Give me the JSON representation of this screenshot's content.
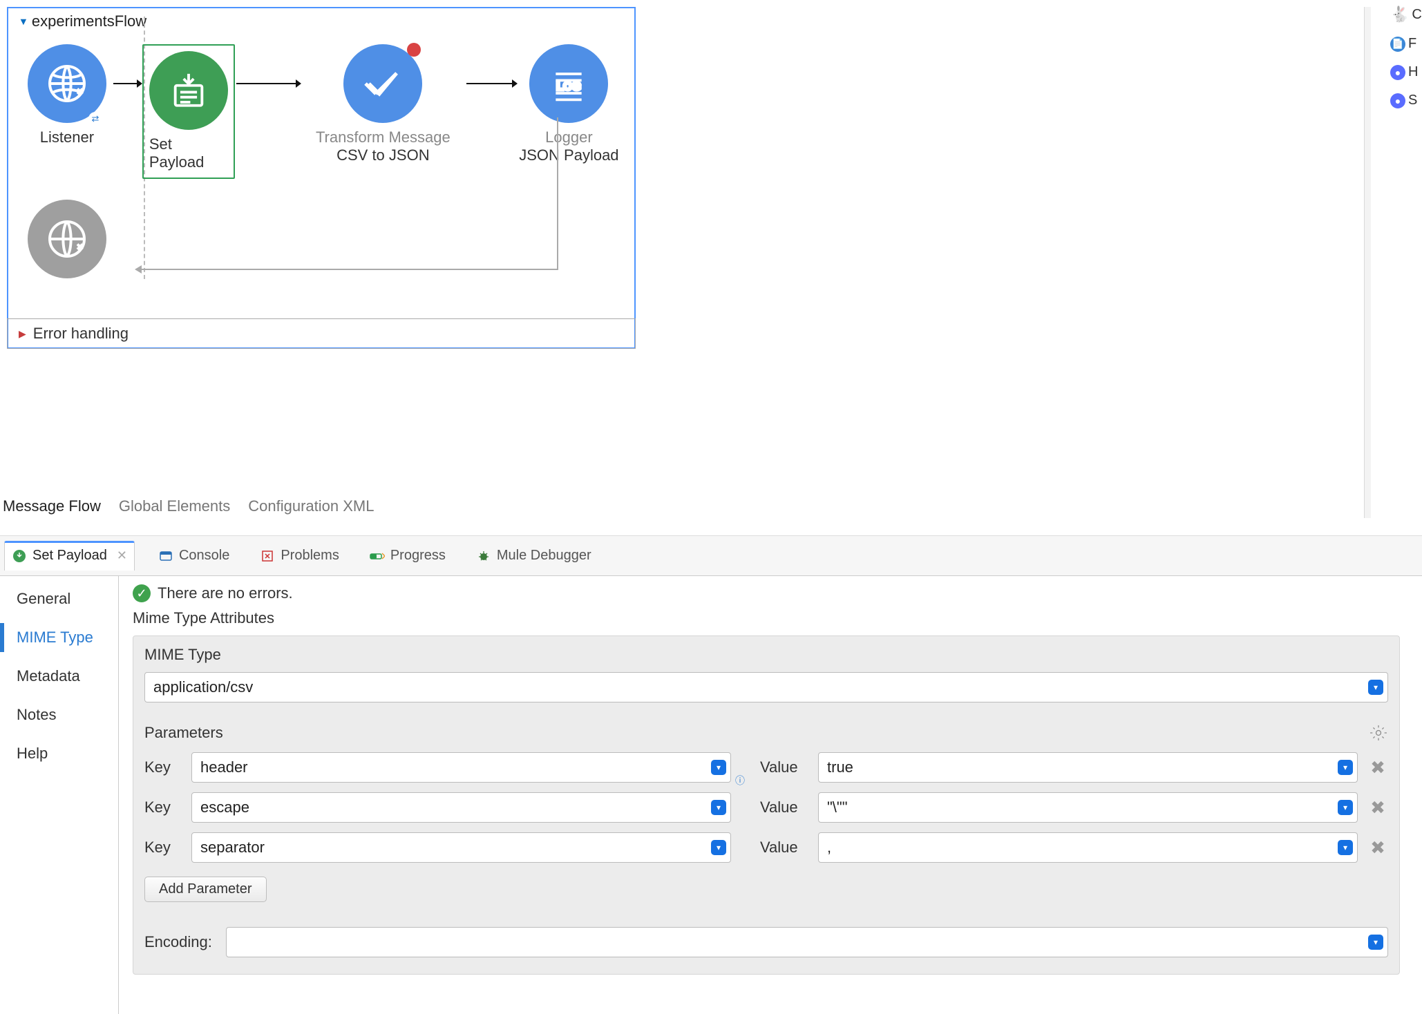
{
  "flow": {
    "name": "experimentsFlow",
    "error_handling_label": "Error handling",
    "nodes": {
      "listener": {
        "label": "Listener"
      },
      "setpayload": {
        "label": "Set Payload"
      },
      "transform": {
        "label1": "Transform Message",
        "label2": "CSV to JSON"
      },
      "logger": {
        "label1": "Logger",
        "label2": "JSON Payload"
      }
    }
  },
  "canvas_tabs": {
    "message_flow": "Message Flow",
    "global_elements": "Global Elements",
    "config_xml": "Configuration XML"
  },
  "bottom_tabs": {
    "set_payload": "Set Payload",
    "console": "Console",
    "problems": "Problems",
    "progress": "Progress",
    "debugger": "Mule Debugger"
  },
  "side_nav": {
    "general": "General",
    "mime": "MIME Type",
    "metadata": "Metadata",
    "notes": "Notes",
    "help": "Help"
  },
  "detail": {
    "status_msg": "There are no errors.",
    "section_title": "Mime Type Attributes",
    "mime_label": "MIME Type",
    "mime_value": "application/csv",
    "parameters_label": "Parameters",
    "rows": [
      {
        "key_label": "Key",
        "key": "header",
        "value_label": "Value",
        "value": "true"
      },
      {
        "key_label": "Key",
        "key": "escape",
        "value_label": "Value",
        "value": "\"\\\"\""
      },
      {
        "key_label": "Key",
        "key": "separator",
        "value_label": "Value",
        "value": ","
      }
    ],
    "add_parameter": "Add Parameter",
    "encoding_label": "Encoding:",
    "encoding_value": ""
  },
  "rail": {
    "c": "C",
    "f": "F",
    "h": "H",
    "s": "S"
  }
}
